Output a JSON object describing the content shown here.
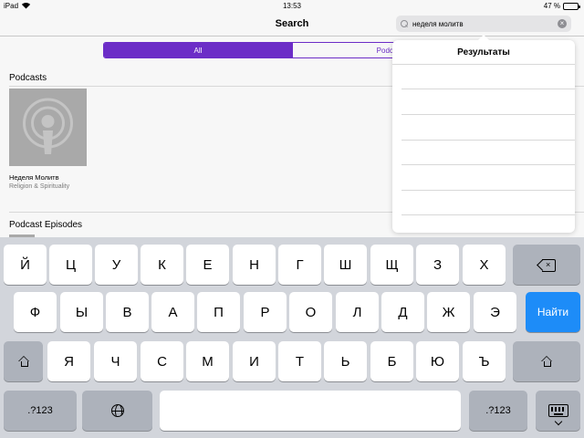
{
  "status": {
    "device": "iPad",
    "time": "13:53",
    "battery_text": "47 %",
    "battery_level": 0.47
  },
  "nav": {
    "title": "Search"
  },
  "search": {
    "query": "неделя молитв",
    "clear_icon": "clear-icon"
  },
  "segments": [
    {
      "label": "All",
      "active": true
    },
    {
      "label": "Podca",
      "active": false
    }
  ],
  "podcasts": {
    "title": "Podcasts",
    "items": [
      {
        "name": "Неделя Молитв",
        "category": "Religion & Spirituality"
      }
    ]
  },
  "episodes": {
    "title": "Podcast Episodes"
  },
  "popover": {
    "title": "Результаты"
  },
  "keyboard": {
    "row1": [
      "Й",
      "Ц",
      "У",
      "К",
      "Е",
      "Н",
      "Г",
      "Ш",
      "Щ",
      "З",
      "Х"
    ],
    "row2": [
      "Ф",
      "Ы",
      "В",
      "А",
      "П",
      "Р",
      "О",
      "Л",
      "Д",
      "Ж",
      "Э"
    ],
    "row3": [
      "Я",
      "Ч",
      "С",
      "М",
      "И",
      "Т",
      "Ь",
      "Б",
      "Ю",
      "Ъ"
    ],
    "go_label": "Найти",
    "numbers_label": ".?123",
    "accent_color": "#1d8cf8"
  },
  "colors": {
    "segment_accent": "#6c2dc7"
  }
}
